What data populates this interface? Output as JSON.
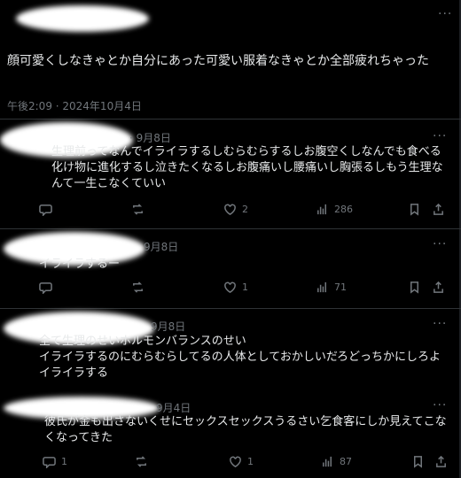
{
  "main_post": {
    "text": "顔可愛くしなきゃとか自分にあった可愛い服着なきゃとか全部疲れちゃった",
    "timestamp": "午後2:09 · 2024年10月4日"
  },
  "replies": [
    {
      "date_fragment": "· 9月8日",
      "text": "生理前ってなんでイライラするしむらむらするしお腹空くしなんでも食べる化け物に進化するし泣きたくなるしお腹痛いし腰痛いし胸張るしもう生理なんて一生こなくていい",
      "like_count": "2",
      "view_count": "286"
    },
    {
      "date_fragment": "9月8日",
      "text": "イライラするー",
      "like_count": "1",
      "view_count": "71"
    },
    {
      "date_fragment": "9月8日",
      "text": "全て生理のせいホルモンバランスのせい\nイライラするのにむらむらしてるの人体としておかしいだろどっちかにしろよイライラする",
      "like_count": "",
      "view_count": ""
    },
    {
      "date_fragment": "9月4日",
      "text": "彼氏が金も出さないくせにセックスセックスうるさい乞食客にしか見えてこなくなってきた",
      "reply_count": "1",
      "like_count": "1",
      "view_count": "87"
    }
  ],
  "more_label": "···",
  "colors": {
    "background": "#000000",
    "text": "#e7e9ea",
    "muted": "#71767b",
    "divider": "#2f3336"
  }
}
